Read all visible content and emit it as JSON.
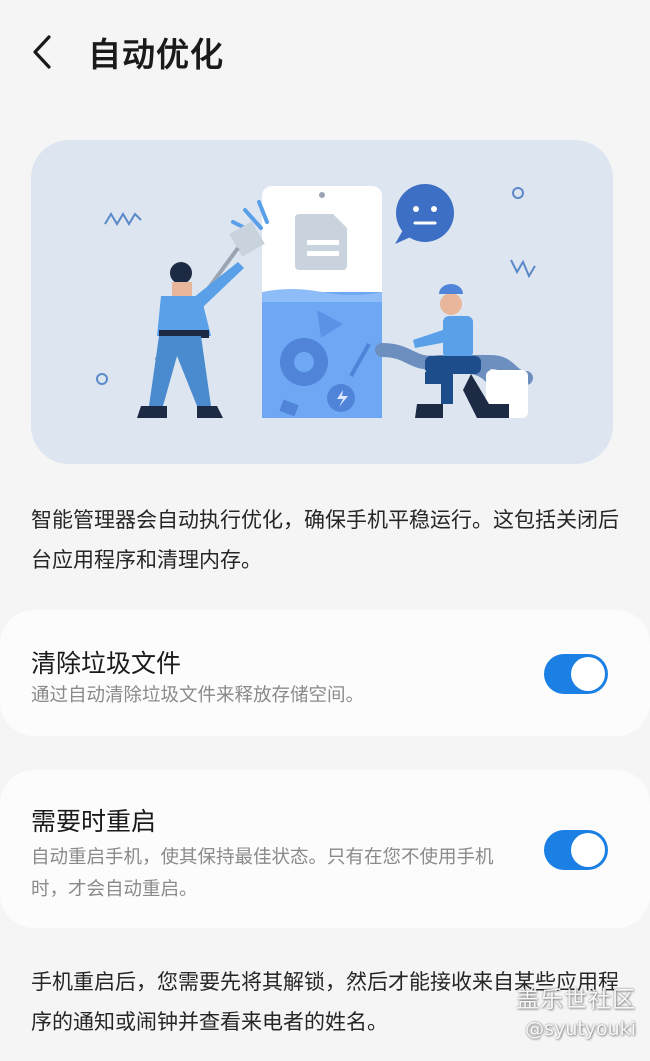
{
  "header": {
    "title": "自动优化",
    "back_icon": "chevron-left-icon"
  },
  "illustration": {
    "name": "auto-optimization-illustration",
    "background": "#dde6f0"
  },
  "intro": {
    "text": "智能管理器会自动执行优化，确保手机平稳运行。这包括关闭后台应用程序和清理内存。"
  },
  "settings": {
    "clean_junk": {
      "title": "清除垃圾文件",
      "description": "通过自动清除垃圾文件来释放存储空间。",
      "enabled": true
    },
    "restart_when_needed": {
      "title": "需要时重启",
      "description": "自动重启手机，使其保持最佳状态。只有在您不使用手机时，才会自动重启。",
      "enabled": true
    }
  },
  "footer": {
    "note": "手机重启后，您需要先将其解锁，然后才能接收来自某些应用程序的通知或闹钟并查看来电者的姓名。"
  },
  "watermark": {
    "line1": "盖乐世社区",
    "line2": "@syutyouki"
  },
  "colors": {
    "accent": "#1b7fe3",
    "background": "#f5f5f5",
    "card": "#fcfcfc",
    "secondary_text": "#8a8a8a"
  }
}
